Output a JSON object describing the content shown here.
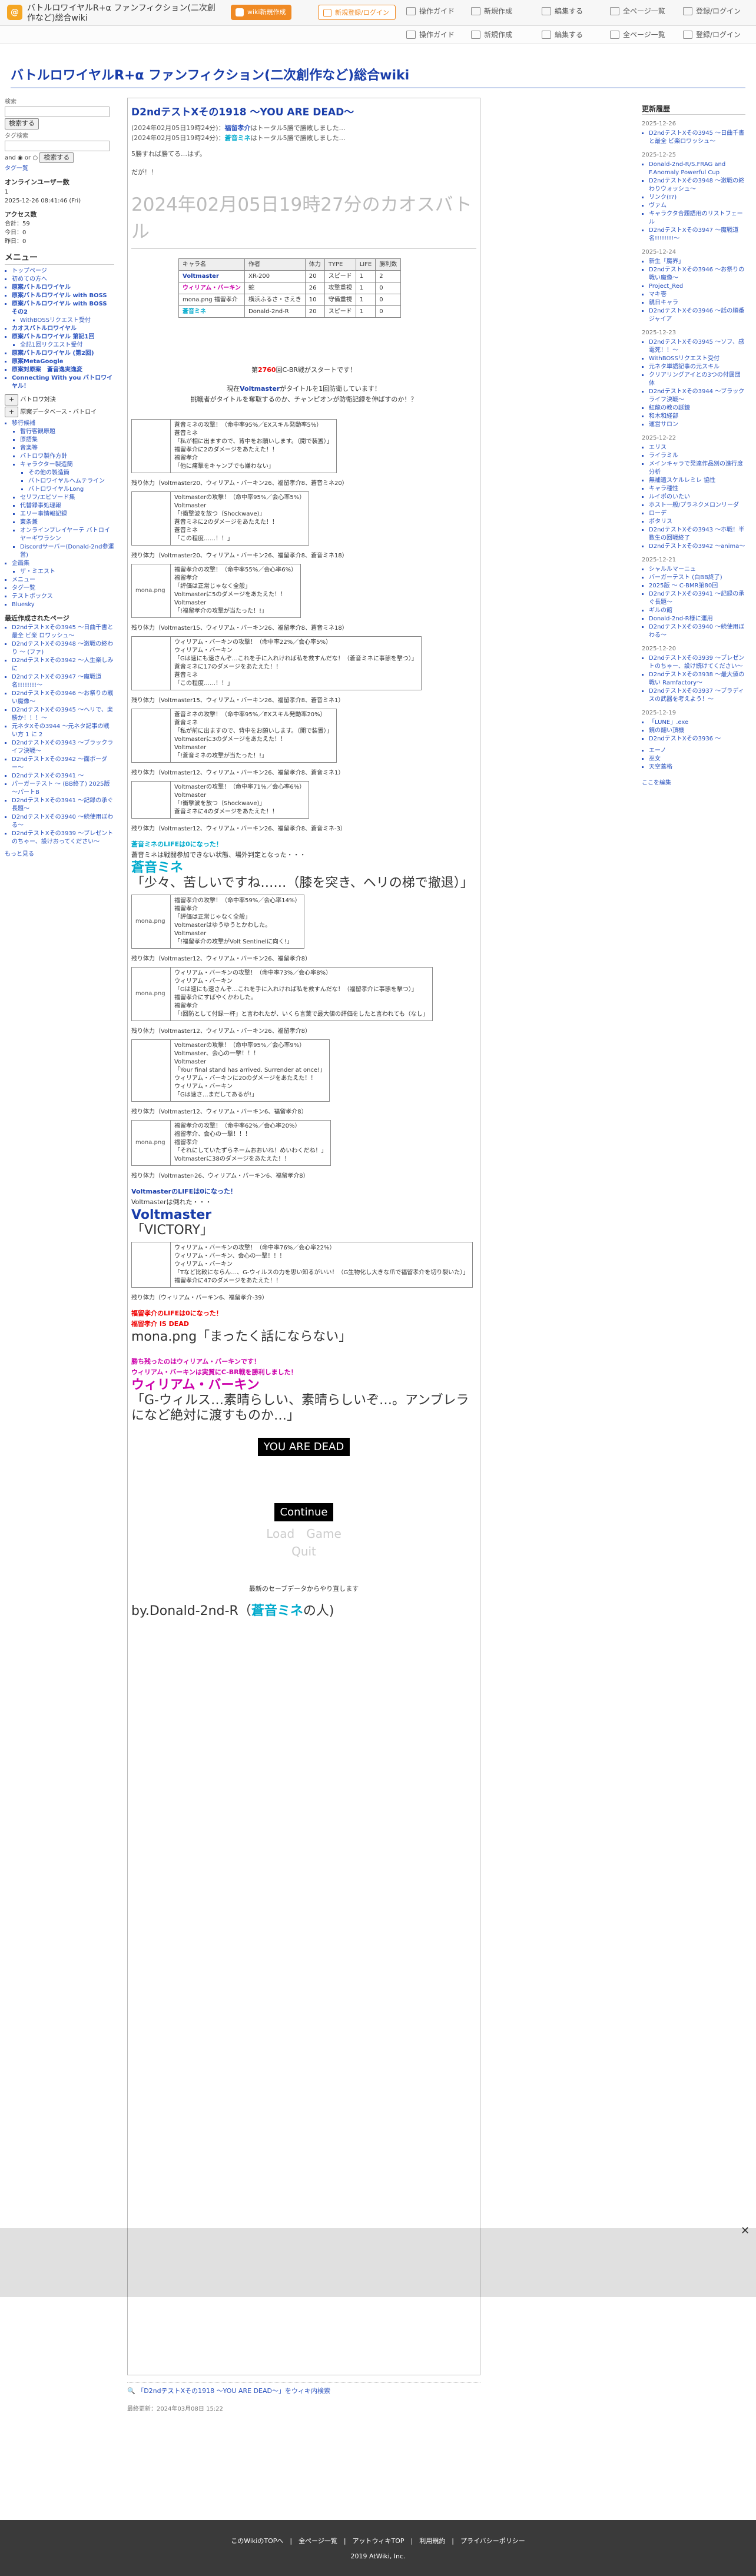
{
  "site": {
    "logo": "@",
    "name": "バトルロワイヤルR+α ファンフィクション(二次創作など)総合wiki",
    "title": "バトルロワイヤルR+α ファンフィクション(二次創作など)総合wiki"
  },
  "toolbar": {
    "btn1": "wiki新規作成",
    "btn2": "新規登録/ログイン",
    "links": [
      "操作ガイド",
      "新規作成",
      "編集する",
      "全ページ一覧",
      "登録/ログイン"
    ]
  },
  "left": {
    "search_label": "検索",
    "search_btn": "検索する",
    "tag_label": "タグ検索",
    "tag_btn": "検索する",
    "and": "and",
    "or": "or",
    "tag_list": "タグ一覧",
    "online_title": "オンラインユーザー数",
    "online_count": "1",
    "online_date": "2025-12-26 08:41:46 (Fri)",
    "access_title": "アクセス数",
    "access_total": "合計：59",
    "access_today": "今日：0",
    "access_yday": "昨日：0",
    "menu_title": "メニュー",
    "menu": [
      "トップページ",
      "初めての方へ",
      "原案バトルロワイヤル",
      "原案バトルロワイヤル with BOSS",
      "原案バトルロワイヤル with BOSS その2",
      "WithBOSSリクエスト受付",
      "カオスバトルロワイヤル",
      "原案バトルロワイヤル 第記1回",
      "全記1回リクエスト受付",
      "原案バトルロワイヤル (第2回)",
      "原案MetaGoogle",
      "原案対原案　蒼音逸実逸変",
      "Connecting With you バトロワイヤル！"
    ],
    "btn1": "バトロワ対決",
    "btn2": "原案データベース・バトロイ",
    "sub": [
      "移行候補",
      "暫行客観原題",
      "原語集",
      "音楽等",
      "バトロワ製作方針",
      "キャラクター製造簡",
      "その他の製造簡",
      "バトロワイヤルへムテライン",
      "バトロワイヤルLong",
      "セリフ/エピソード集",
      "代替録事処理報",
      "エリー事情報記録",
      "東条兼",
      "オンラインプレイヤーテ バトロイヤーギワラシン",
      "Discordサーバー(Donald-2nd参運営)",
      "企画集",
      "ザ・ミエスト"
    ],
    "etc": [
      "メニュー",
      "タグ一覧",
      "テストボックス",
      "Bluesky"
    ],
    "recent_title": "最近作成されたページ",
    "recent": [
      "D2ndテストXその3945 〜日曲千書と最全 ビ楽 ロワッシュ〜",
      "D2ndテストXその3948 〜激戦の終わり 〜 (ファ)",
      "D2ndテストXその3942 〜人生楽しみに",
      "D2ndテストXその3947 〜魔戦道名!!!!!!!!〜",
      "D2ndテストXその3946 〜お祭りの戦い魔像〜",
      "D2ndテストXその3945 〜ヘリで、楽勝か！！！〜",
      "元ネタXその3944 〜元ネタ記事の戦い方 1 に 2",
      "D2ndテストXその3943 〜ブラックライフ決戦〜",
      "D2ndテストXその3942 〜面ポーダー〜",
      "D2ndテストXその3941 〜",
      "パーガーテスト 〜 (BB終了) 2025版 〜パートB",
      "D2ndテストXその3941 〜記録の承ぐ長題〜",
      "D2ndテストXその3940 〜続使用ぼわる〜",
      "D2ndテストXその3939 〜ブレゼントのちゃー、設けおってください〜"
    ],
    "more": "もっと見る"
  },
  "right": {
    "title": "更新履歴",
    "groups": [
      {
        "date": "2025-12-26",
        "items": [
          "D2ndテストXその3945 〜日曲千書と最全 ビ楽ロワッシュ〜"
        ]
      },
      {
        "date": "2025-12-25",
        "items": [
          "Donald-2nd-R/S.FRAG and F.Anomaly Powerful Cup",
          "D2ndテストXその3948 〜激戦の終わりウォッシュ〜",
          "リンク(!?)",
          "ヴァム",
          "キャラクタ合題語用のリストフェール",
          "D2ndテストXその3947 〜魔戦道名!!!!!!!!〜"
        ]
      },
      {
        "date": "2025-12-24",
        "items": [
          "新生「魔界」",
          "D2ndテストXその3946 〜お祭りの戦い魔像〜",
          "Project_Red",
          "マキ壱",
          "親日キャラ",
          "D2ndテストXその3946 〜話の順番 ジャイア"
        ]
      },
      {
        "date": "2025-12-23",
        "items": [
          "D2ndテストXその3945 〜ソフ、感電死！！〜",
          "WithBOSSリクエスト受付",
          "元ネタ単語記事の元スキル",
          "クリアリングアイとの3つの付属団体",
          "D2ndテストXその3944 〜ブラックライフ決戦〜",
          "紅龍の教の誕鏡",
          "和木和経部",
          "運営サロン"
        ]
      },
      {
        "date": "2025-12-22",
        "items": [
          "エリス",
          "ライラミル",
          "メインキャラで発達作品別の進行度分析",
          "無補遺スケルレミレ 協性",
          "キャラ種性",
          "ルイポのいたい",
          "ホスト一般/プラネクメロンリーダ",
          "ローデ",
          "ポタリス",
          "D2ndテストXその3943 〜ホ戦！半数生の回戦終了",
          "D2ndテストXその3942 〜anima〜"
        ]
      },
      {
        "date": "2025-12-21",
        "items": [
          "シャルルマーニュ",
          "バーガーテスト (白BB終了)",
          "2025版 〜 C-BMR第80回",
          "D2ndテストXその3941 〜記録の承ぐ長題〜",
          "ギルの館",
          "Donald-2nd-R様に運用",
          "D2ndテストXその3940 〜続使用ぼわる〜"
        ]
      },
      {
        "date": "2025-12-20",
        "items": [
          "D2ndテストXその3939 〜ブレゼントのちゃー、設け続けてください〜",
          "D2ndテストXその3938 〜最大値の戦い Ramfactory〜",
          "D2ndテストXその3937 〜ブラディスの武器を考えよう！〜"
        ]
      },
      {
        "date": "2025-12-19",
        "items": [
          "「LUNE」.exe",
          "鏡の翻い頂機",
          "D2ndテストXその3936 〜"
        ]
      },
      {
        "date": "",
        "items": [
          "エーノ",
          "巫女",
          "天空蓋格"
        ]
      }
    ],
    "more": "ここを編集"
  },
  "page": {
    "title": "D2ndテストXその1918 〜YOU ARE DEAD〜",
    "meta1_pre": "(2024年02月05日19時24分)：",
    "meta1_name": "福留孝介",
    "meta1_post": "はトータル5勝で勝敗しました…",
    "meta2_pre": "(2024年02月05日19時24分)：",
    "meta2_name": "蒼音ミネ",
    "meta2_post": "はトータル5勝で勝敗しました…",
    "meta3": "5勝すれば勝てる…はず。",
    "meta4": "だが！！",
    "big_date": "2024年02月05日19時27分のカオスバトル",
    "table_headers": [
      "キャラ名",
      "作者",
      "体力",
      "TYPE",
      "LIFE",
      "勝利数"
    ],
    "table_rows": [
      [
        "Voltmaster",
        "XR-200",
        "20",
        "スピード",
        "1",
        "2"
      ],
      [
        "ウィリアム・バーキン",
        "蛇",
        "26",
        "攻撃重視",
        "1",
        "0"
      ],
      [
        "mona.png 福留孝介",
        "横浜ふるさ・さえき",
        "10",
        "守備重視",
        "1",
        "0"
      ],
      [
        "蒼音ミネ",
        "Donald-2nd-R",
        "20",
        "スピード",
        "1",
        "0"
      ]
    ],
    "start_pre": "第",
    "start_num": "2760",
    "start_post": "回C-BR戦がスタートです！",
    "notice1_pre": "現在",
    "notice1_name": "Voltmaster",
    "notice1_post": "がタイトルを1回防衛しています！",
    "notice2": "挑戦者がタイトルを奪取するのか、チャンピオンが防衛記録を伸ばすのか！？",
    "rounds": [
      {
        "img": "",
        "lines": [
          "蒼音ミネの攻撃！（命中率95%／EXスキル発動率5%）",
          "蒼音ミネ",
          "「私が相に出ますので、背中をお願いします。（開で装置）」",
          "福留孝介に2のダメージをあたえた！！",
          "福留孝介",
          "「他に痛撃をキャンプでも嫌わない」"
        ],
        "remain": "残り体力（Voltmaster20、ウィリアム・バーキン26、福留孝介8、蒼音ミネ20）"
      },
      {
        "img": "",
        "lines": [
          "Voltmasterの攻撃！（命中率95%／会心率5%）",
          "Voltmaster",
          "「!衝撃波を放つ（Shockwave)」",
          "蒼音ミネに2のダメージをあたえた！！",
          "蒼音ミネ",
          "「この程度……！！」"
        ],
        "remain": "残り体力（Voltmaster20、ウィリアム・バーキン26、福留孝介8、蒼音ミネ18）"
      },
      {
        "img": "mona.png",
        "lines": [
          "福留孝介の攻撃！（命中率55%／会心率6%）",
          "福留孝介",
          "「評価は正常じゃなく全般」",
          "Voltmasterに5のダメージをあたえた！！",
          "Voltmaster",
          "「!福留孝介の攻撃が当たった！!」"
        ],
        "remain": "残り体力（Voltmaster15、ウィリアム・バーキン26、福留孝介8、蒼音ミネ18）"
      },
      {
        "img": "",
        "lines": [
          "ウィリアム・バーキンの攻撃！（命中率22%／会心率5%）",
          "ウィリアム・バーキン",
          "「Gは速にも速さんぞ…これを手に入れければ私を救すんだな！（蒼音ミネに事態を撃つ）」",
          "蒼音ミネに17のダメージをあたえた！！",
          "蒼音ミネ",
          "「この程度……！！」"
        ],
        "remain": "残り体力（Voltmaster15、ウィリアム・バーキン26、福留孝介8、蒼音ミネ1）"
      },
      {
        "img": "",
        "lines": [
          "蒼音ミネの攻撃！（命中率95%／EXスキル発動率20%）",
          "蒼音ミネ",
          "「私が前に出ますので、背中をお願いします。（開で装置）」",
          "Voltmasterに3のダメージをあたえた！！",
          "Voltmaster",
          "「!蒼音ミネの攻撃が当たった！!」"
        ],
        "remain": "残り体力（Voltmaster12、ウィリアム・バーキン26、福留孝介8、蒼音ミネ1）"
      },
      {
        "img": "",
        "lines": [
          "Voltmasterの攻撃！（命中率71%／会心率6%）",
          "Voltmaster",
          "「!衝撃波を放つ（Shockwave)」",
          "蒼音ミネに4のダメージをあたえた！！"
        ],
        "remain": "残り体力（Voltmaster12、ウィリアム・バーキン26、福留孝介8、蒼音ミネ-3）"
      }
    ],
    "death1_a": "蒼音ミネのLIFEは0になった！",
    "death1_b": "蒼音ミネは戦闘参加できない状態、場外判定となった・・・",
    "death1_name": "蒼音ミネ",
    "death1_quote": "「少々、苦しいですね……（膝を突き、ヘリの梯で撤退）」",
    "round7": {
      "img": "mona.png",
      "lines": [
        "福留孝介の攻撃！（命中率59%／会心率14%）",
        "福留孝介",
        "「評価は正常じゃなく全般」",
        "Voltmasterはゆうゆうとかわした。",
        "Voltmaster",
        "「!福留孝介の攻撃がVolt Sentinelに向く!」"
      ],
      "remain": "残り体力（Voltmaster12、ウィリアム・バーキン26、福留孝介8）"
    },
    "round8": {
      "img": "mona.png",
      "lines": [
        "ウィリアム・バーキンの攻撃！（命中率73%／会心率8%）",
        "ウィリアム・バーキン",
        "「Gは速にも速さんぞ…これを手に入れければ私を救すんだな！（福留孝介に事態を撃つ）」",
        "福留孝介にすばやくかわした。",
        "福留孝介",
        "「!回防として付録一杯」と言われたが、いくら言葉で最大値の評価をしたと言われても（なし」"
      ],
      "remain": "残り体力（Voltmaster12、ウィリアム・バーキン26、福留孝介8）"
    },
    "round9": {
      "lines": [
        "Voltmasterの攻撃！（命中率95%／会心率9%）",
        "Voltmaster、会心の一撃！！！",
        "Voltmaster",
        "「Your final stand has arrived. Surrender at once!」",
        "ウィリアム・バーキンに20のダメージをあたえた！！",
        "ウィリアム・バーキン",
        "「Gは速さ…まだしてあるが!」"
      ],
      "remain": "残り体力（Voltmaster12、ウィリアム・バーキン6、福留孝介8）"
    },
    "round10": {
      "img": "mona.png",
      "lines": [
        "福留孝介の攻撃！（命中率62%／会心率20%）",
        "福留孝介、会心の一撃！！！",
        "福留孝介",
        "「それにしていたずらネームおおいね！めいわくだね！」",
        "Voltmasterに38のダメージをあたえた！！"
      ],
      "remain": "残り体力（Voltmaster-26、ウィリアム・バーキン6、福留孝介8）"
    },
    "death2_a": "VoltmasterのLIFEは0になった！",
    "death2_b": "Voltmasterは倒れた・・・",
    "death2_name": "Voltmaster",
    "death2_quote": "「VICTORY」",
    "round11": {
      "lines": [
        "ウィリアム・バーキンの攻撃！（命中率76%／会心率22%）",
        "ウィリアム・バーキン、会心の一撃！！！",
        "ウィリアム・バーキン",
        "「Tなど比較にならん…、G-ウィルスの力を思い知るがいい！（G生物化し大きな爪で福留孝介を切り裂いた）」",
        "福留孝介に47のダメージをあたえた！！"
      ],
      "remain": "残り体力（ウィリアム・バーキン6、福留孝介-39）"
    },
    "death3_a": "福留孝介のLIFEは0になった！",
    "death3_b": "福留孝介 IS DEAD",
    "death3_quote": "mona.png「まったく話にならない」",
    "winner_a": "勝ち残ったのはウィリアム・バーキンです！",
    "winner_b": "ウィリアム・バーキンは実質にC-BR戦を勝利しました！",
    "winner_name": "ウィリアム・バーキン",
    "winner_quote": "「G-ウィルス…素晴らしい、素晴らしいぞ…。アンブレラになど絶対に渡すものか…」",
    "dead": "YOU ARE DEAD",
    "continue": "Continue",
    "load": "Load",
    "game": "Game",
    "quit": "Quit",
    "save_note": "最新のセーブデータからやり直します",
    "by": "by.Donald-2nd-R（",
    "by_name": "蒼音ミネ",
    "by_post": "の人)",
    "bottom_link": "「D2ndテストXその1918 〜YOU ARE DEAD〜」をウィキ内検索",
    "updated": "最終更新：2024年03月08日 15:22"
  },
  "footer": {
    "links": "このWikiのTOPへ　|　全ページ一覧　|　アットウィキTOP　|　利用規約　|　プライバシーポリシー",
    "copy": "2019 AtWiki, Inc."
  }
}
